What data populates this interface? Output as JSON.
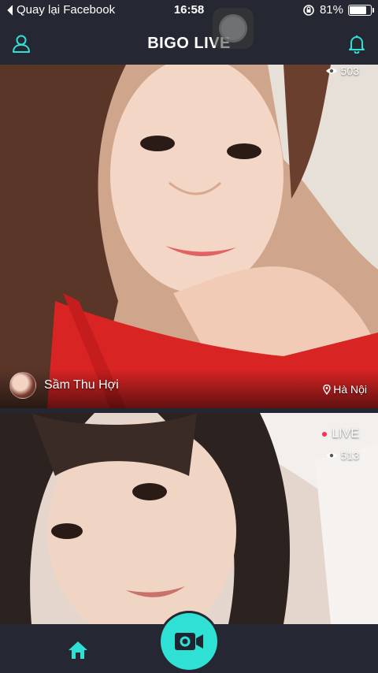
{
  "status_bar": {
    "back_label": "Quay lại Facebook",
    "time": "16:58",
    "battery_percent": "81%",
    "battery_level": 0.81
  },
  "nav": {
    "title": "BIGO LIVE",
    "profile_icon": "user-icon",
    "notification_icon": "bell-icon",
    "accent_color": "#2ee1d4"
  },
  "streams": [
    {
      "viewers": "503",
      "host_name": "Sầm Thu Hợi",
      "location": "Hà Nội"
    },
    {
      "live_label": "LIVE",
      "viewers": "513"
    }
  ],
  "tab_bar": {
    "home_icon": "home-icon",
    "broadcast_icon": "video-camera-icon"
  }
}
